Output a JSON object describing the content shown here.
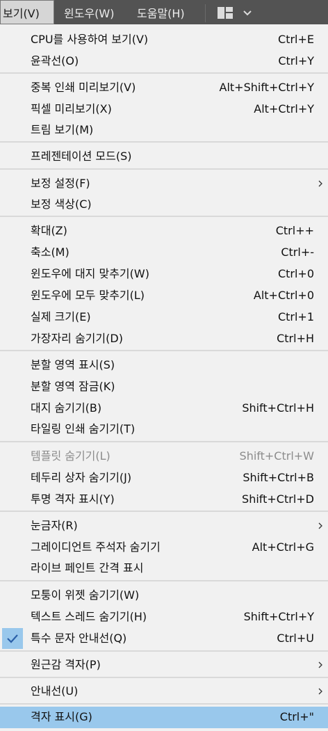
{
  "menubar": {
    "view": "보기(V)",
    "window": "윈도우(W)",
    "help": "도움말(H)"
  },
  "colors": {
    "highlight": "#99c8ec",
    "menu_bg": "#f1f1f1",
    "bar_bg": "#535353"
  },
  "menu": {
    "cpu_view": {
      "label": "CPU를 사용하여 보기(V)",
      "shortcut": "Ctrl+E"
    },
    "outline": {
      "label": "윤곽선(O)",
      "shortcut": "Ctrl+Y"
    },
    "overprint_preview": {
      "label": "중복 인쇄 미리보기(V)",
      "shortcut": "Alt+Shift+Ctrl+Y"
    },
    "pixel_preview": {
      "label": "픽셀 미리보기(X)",
      "shortcut": "Alt+Ctrl+Y"
    },
    "trim_view": {
      "label": "트림 보기(M)"
    },
    "presentation_mode": {
      "label": "프레젠테이션 모드(S)"
    },
    "proof_setup": {
      "label": "보정 설정(F)"
    },
    "proof_colors": {
      "label": "보정 색상(C)"
    },
    "zoom_in": {
      "label": "확대(Z)",
      "shortcut": "Ctrl++"
    },
    "zoom_out": {
      "label": "축소(M)",
      "shortcut": "Ctrl+-"
    },
    "fit_artboard": {
      "label": "윈도우에 대지 맞추기(W)",
      "shortcut": "Ctrl+0"
    },
    "fit_all": {
      "label": "윈도우에 모두 맞추기(L)",
      "shortcut": "Alt+Ctrl+0"
    },
    "actual_size": {
      "label": "실제 크기(E)",
      "shortcut": "Ctrl+1"
    },
    "hide_edges": {
      "label": "가장자리 숨기기(D)",
      "shortcut": "Ctrl+H"
    },
    "show_slices": {
      "label": "분할 영역 표시(S)"
    },
    "lock_slices": {
      "label": "분할 영역 잠금(K)"
    },
    "hide_artboards": {
      "label": "대지 숨기기(B)",
      "shortcut": "Shift+Ctrl+H"
    },
    "hide_print_tiling": {
      "label": "타일링 인쇄 숨기기(T)"
    },
    "hide_template": {
      "label": "템플릿 숨기기(L)",
      "shortcut": "Shift+Ctrl+W"
    },
    "hide_bounding_box": {
      "label": "테두리 상자 숨기기(J)",
      "shortcut": "Shift+Ctrl+B"
    },
    "show_transparency_grid": {
      "label": "투명 격자 표시(Y)",
      "shortcut": "Shift+Ctrl+D"
    },
    "rulers": {
      "label": "눈금자(R)"
    },
    "hide_gradient_annotator": {
      "label": "그레이디언트 주석자 숨기기",
      "shortcut": "Alt+Ctrl+G"
    },
    "show_live_paint_gaps": {
      "label": "라이브 페인트 간격 표시"
    },
    "hide_corner_widget": {
      "label": "모퉁이 위젯 숨기기(W)"
    },
    "hide_text_threads": {
      "label": "텍스트 스레드 숨기기(H)",
      "shortcut": "Shift+Ctrl+Y"
    },
    "special_char_guides": {
      "label": "특수 문자 안내선(Q)",
      "shortcut": "Ctrl+U"
    },
    "perspective_grid": {
      "label": "원근감 격자(P)"
    },
    "guides": {
      "label": "안내선(U)"
    },
    "show_grid": {
      "label": "격자 표시(G)",
      "shortcut": "Ctrl+\""
    }
  }
}
